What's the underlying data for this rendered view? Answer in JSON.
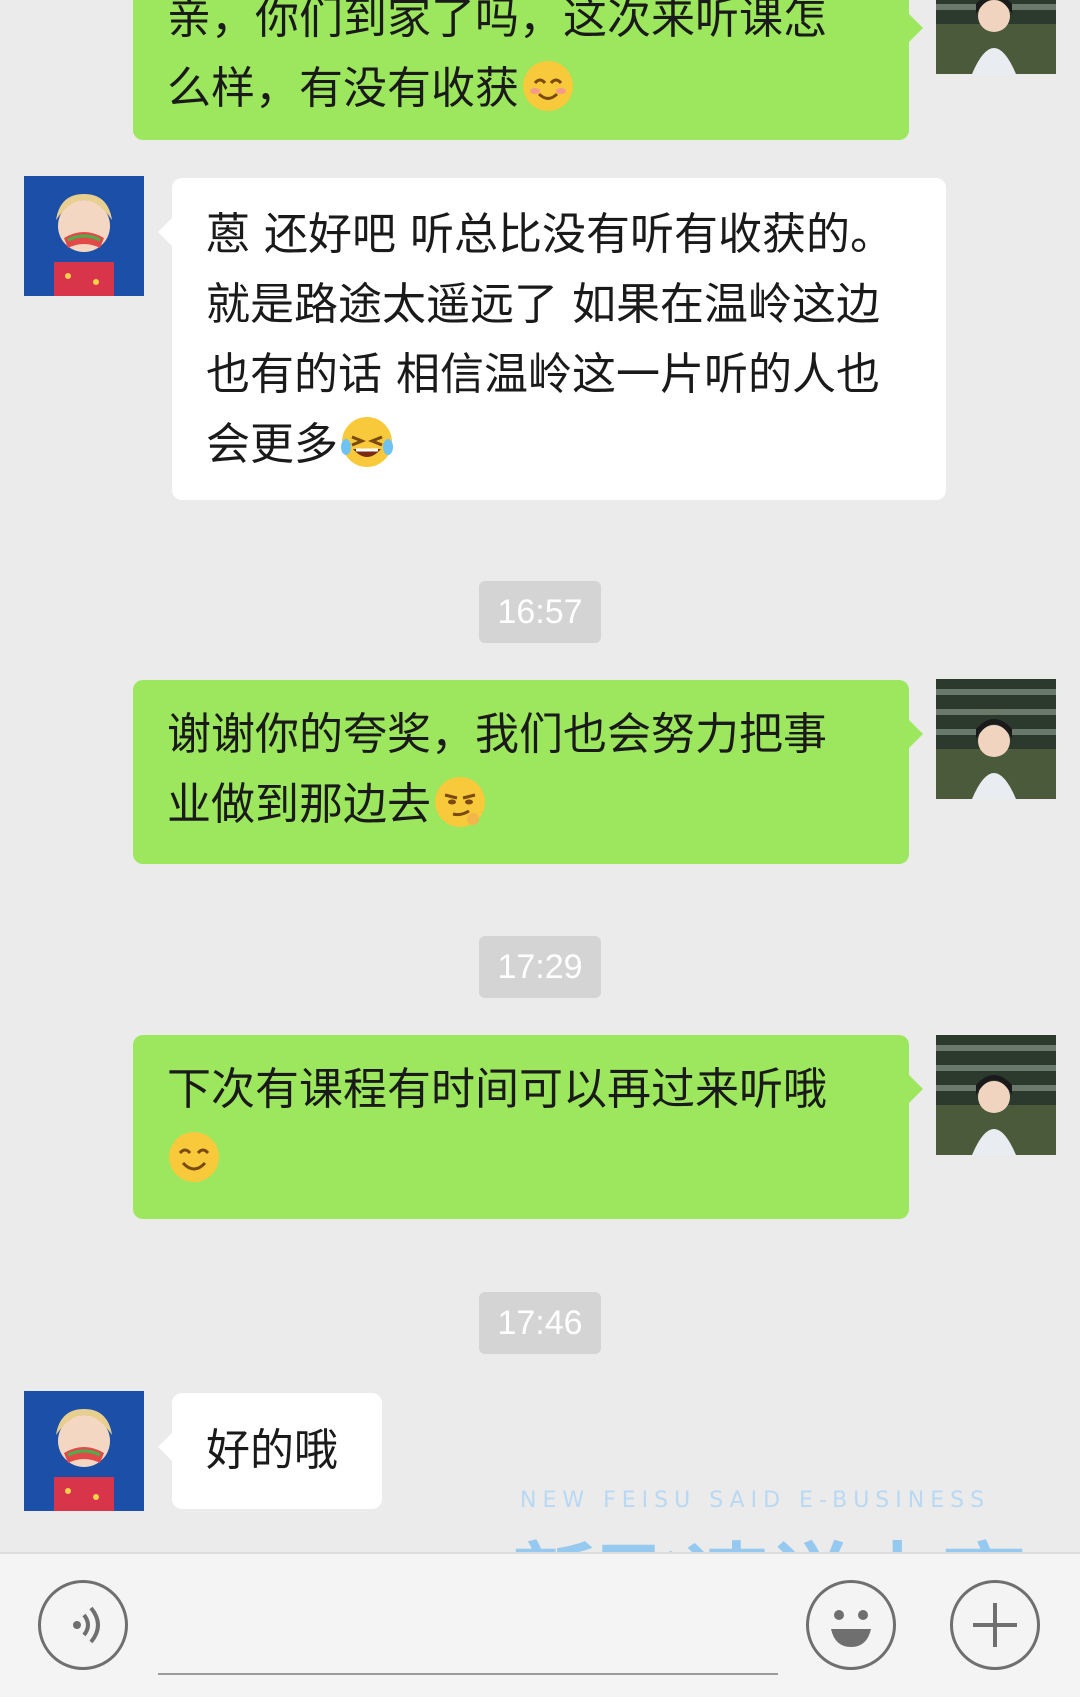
{
  "messages": [
    {
      "side": "sent",
      "lines": [
        "亲，你们到家了吗，这次来听课怎",
        "么样，有没有收获"
      ],
      "emoji": "blush-emoji"
    },
    {
      "side": "received",
      "lines": [
        "蒽 还好吧 听总比没有听有收获的。",
        "就是路途太遥远了 如果在温岭这边",
        "也有的话 相信温岭这一片听的人也",
        "会更多"
      ],
      "emoji": "tears-of-joy-emoji"
    },
    {
      "side": "sent",
      "lines": [
        "谢谢你的夸奖，我们也会努力把事",
        "业做到那边去"
      ],
      "emoji": "smirk-emoji"
    },
    {
      "side": "sent",
      "lines": [
        "下次有课程有时间可以再过来听哦",
        ""
      ],
      "emoji": "smile-emoji"
    },
    {
      "side": "received",
      "lines": [
        "好的哦"
      ],
      "emoji": ""
    }
  ],
  "timestamps": [
    "16:57",
    "17:29",
    "17:46"
  ],
  "watermark": {
    "english": "NEW FEISU SAID E-BUSINESS",
    "chinese": "新飞速说电商"
  },
  "input_bar": {
    "voice_icon": "voice-icon",
    "emoji_icon": "emoji-face-icon",
    "more_icon": "plus-icon"
  },
  "colors": {
    "sent_bubble": "#9ce75e",
    "received_bubble": "#ffffff",
    "background": "#ebebeb",
    "timestamp_bg": "#d4d4d4"
  }
}
